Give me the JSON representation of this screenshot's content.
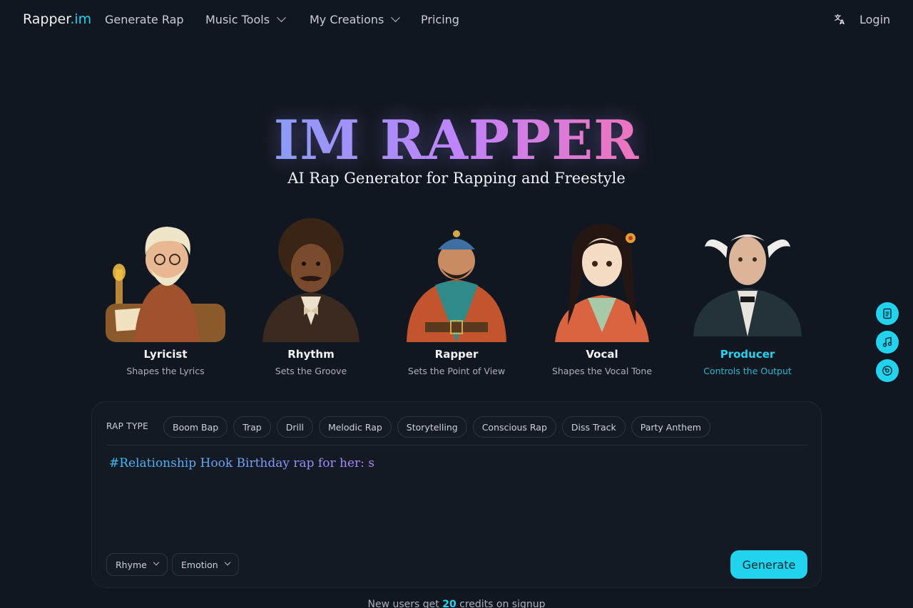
{
  "nav": {
    "brand_main": "Rapper",
    "brand_accent": ".im",
    "links": [
      "Generate Rap",
      "Music Tools",
      "My Creations",
      "Pricing"
    ],
    "lang_icon": "translate-icon",
    "login": "Login"
  },
  "hero": {
    "title": "IM RAPPER",
    "subtitle": "AI Rap Generator for Rapping and Freestyle"
  },
  "characters": [
    {
      "name": "Lyricist",
      "desc": "Shapes the Lyrics"
    },
    {
      "name": "Rhythm",
      "desc": "Sets the Groove"
    },
    {
      "name": "Rapper",
      "desc": "Sets the Point of View"
    },
    {
      "name": "Vocal",
      "desc": "Shapes the Vocal Tone"
    },
    {
      "name": "Producer",
      "desc": "Controls the Output"
    }
  ],
  "editor": {
    "rap_type_label": "RAP TYPE",
    "rap_types": [
      "Boom Bap",
      "Trap",
      "Drill",
      "Melodic Rap",
      "Storytelling",
      "Conscious Rap",
      "Diss Track",
      "Party Anthem"
    ],
    "prompt": "#Relationship Hook Birthday rap for her: s",
    "selects": [
      "Rhyme",
      "Emotion"
    ],
    "generate": "Generate"
  },
  "note": {
    "before": "New users get ",
    "credits": "20",
    "after": " credits on signup"
  },
  "colors": {
    "accent": "#22d3ee",
    "background": "#111720"
  },
  "floating_icons": [
    "document-icon",
    "music-note-icon",
    "disc-icon"
  ]
}
